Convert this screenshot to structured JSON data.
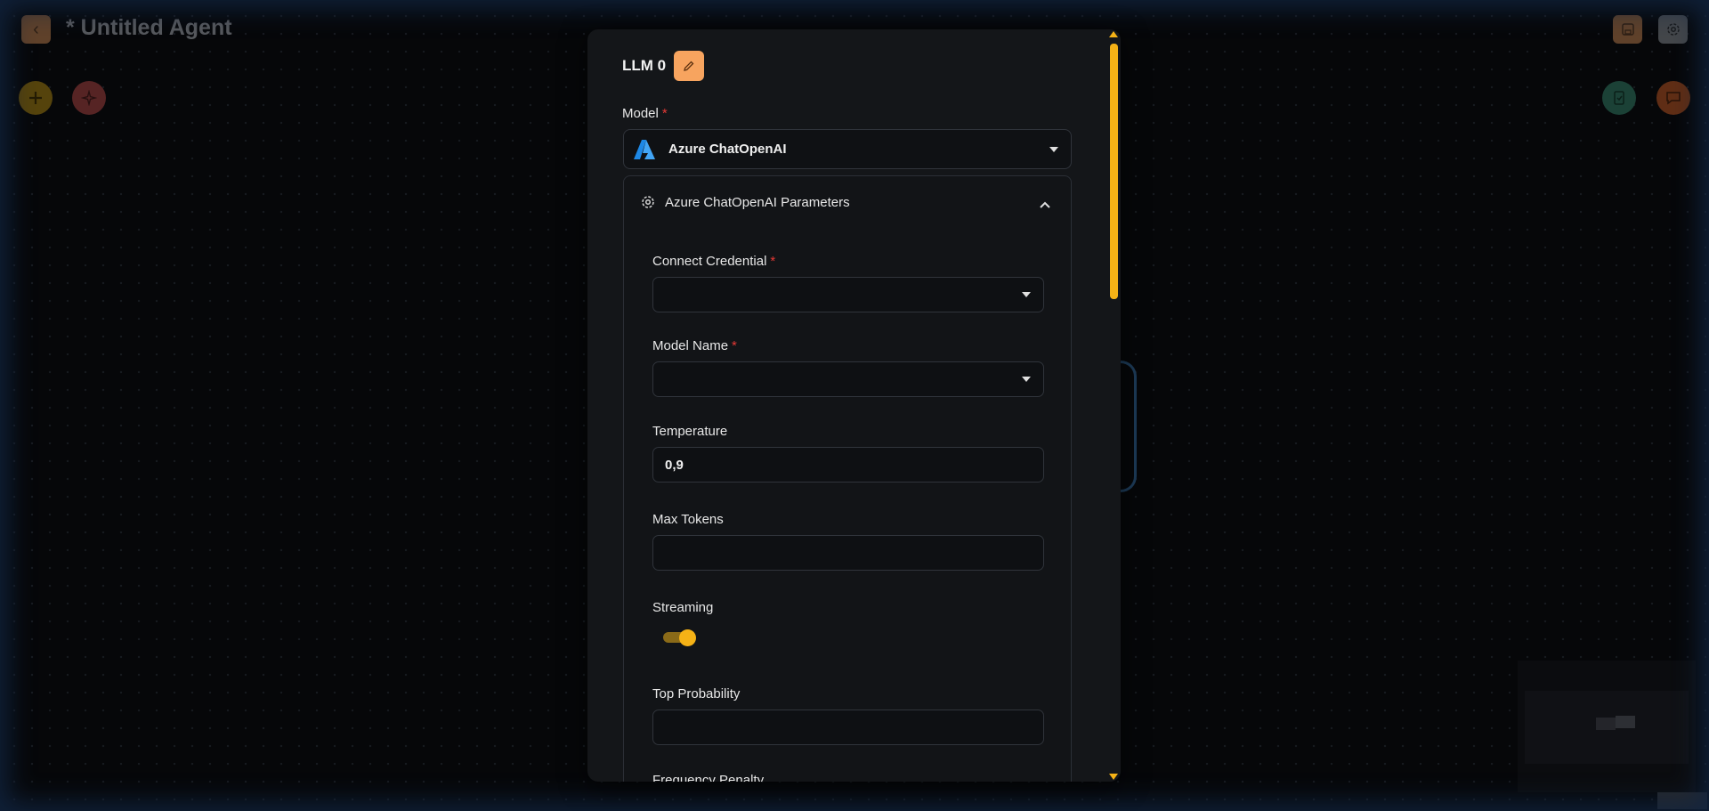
{
  "topbar": {
    "title": "* Untitled Agent",
    "back_icon": "chevron-left-icon",
    "save_icon": "save-icon",
    "settings_icon": "gear-icon"
  },
  "canvas_actions": {
    "add_icon": "plus-icon",
    "magic_icon": "sparkle-icon",
    "validate_icon": "checklist-icon",
    "chat_icon": "chat-icon"
  },
  "dialog": {
    "node_name": "LLM 0",
    "model_label": "Model",
    "required_mark": "*",
    "model_value": "Azure ChatOpenAI",
    "params_title": "Azure ChatOpenAI Parameters",
    "fields": {
      "credential_label": "Connect Credential",
      "credential_value": "",
      "model_name_label": "Model Name",
      "model_name_value": "",
      "temperature_label": "Temperature",
      "temperature_value": "0,9",
      "max_tokens_label": "Max Tokens",
      "max_tokens_value": "",
      "streaming_label": "Streaming",
      "streaming_on": true,
      "top_p_label": "Top Probability",
      "top_p_value": "",
      "frequency_penalty_label": "Frequency Penalty"
    }
  },
  "colors": {
    "accent": "#f5b216",
    "edit_button": "#f7a45f",
    "required": "#e53935",
    "azure_logo": "#1e88e5"
  }
}
